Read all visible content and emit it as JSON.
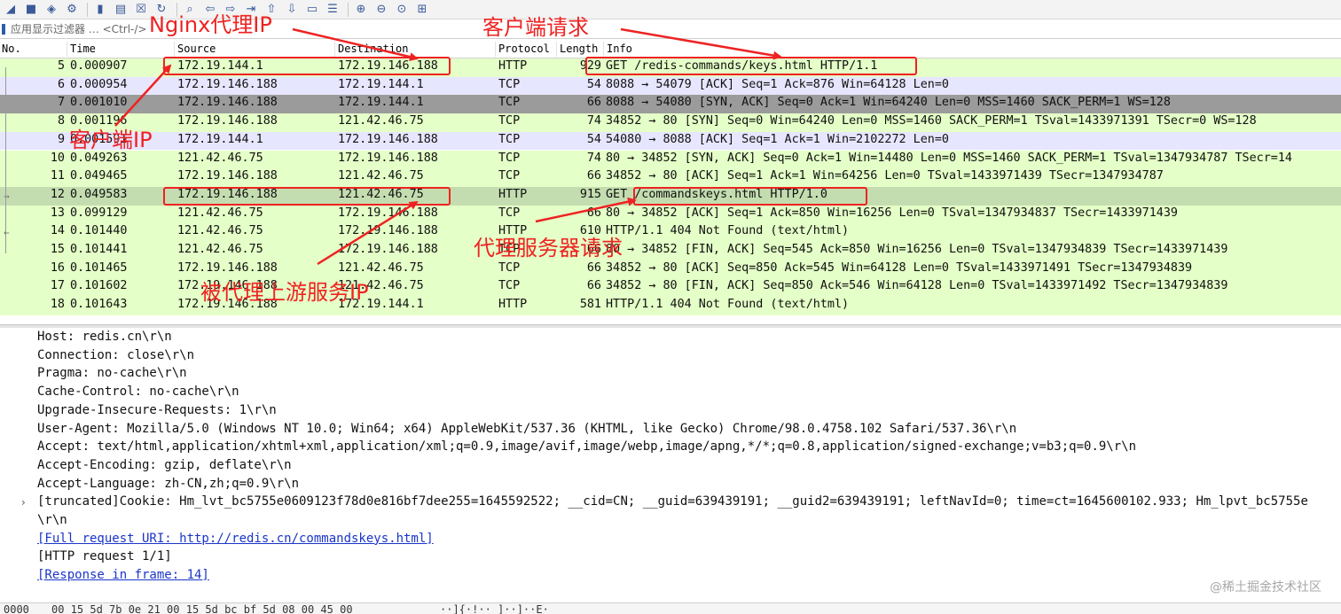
{
  "filter": {
    "placeholder": "应用显示过滤器 … <Ctrl-/>"
  },
  "columns": [
    "No.",
    "Time",
    "Source",
    "Destination",
    "Protocol",
    "Length",
    "Info"
  ],
  "packets": [
    {
      "no": "5",
      "time": "0.000907",
      "src": "172.19.144.1",
      "dst": "172.19.146.188",
      "proto": "HTTP",
      "len": "929",
      "info": "GET /redis-commands/keys.html HTTP/1.1",
      "bg": "#e4ffc7"
    },
    {
      "no": "6",
      "time": "0.000954",
      "src": "172.19.146.188",
      "dst": "172.19.144.1",
      "proto": "TCP",
      "len": "54",
      "info": "8088 → 54079 [ACK] Seq=1 Ack=876 Win=64128 Len=0",
      "bg": "#e7e6ff"
    },
    {
      "no": "7",
      "time": "0.001010",
      "src": "172.19.146.188",
      "dst": "172.19.144.1",
      "proto": "TCP",
      "len": "66",
      "info": "8088 → 54080 [SYN, ACK] Seq=0 Ack=1 Win=64240 Len=0 MSS=1460 SACK_PERM=1 WS=128",
      "bg": "#a0a0a0"
    },
    {
      "no": "8",
      "time": "0.001196",
      "src": "172.19.146.188",
      "dst": "121.42.46.75",
      "proto": "TCP",
      "len": "74",
      "info": "34852 → 80 [SYN] Seq=0 Win=64240 Len=0 MSS=1460 SACK_PERM=1 TSval=1433971391 TSecr=0 WS=128",
      "bg": "#e4ffc7"
    },
    {
      "no": "9",
      "time": "0.001591",
      "src": "172.19.144.1",
      "dst": "172.19.146.188",
      "proto": "TCP",
      "len": "54",
      "info": "54080 → 8088 [ACK] Seq=1 Ack=1 Win=2102272 Len=0",
      "bg": "#e7e6ff"
    },
    {
      "no": "10",
      "time": "0.049263",
      "src": "121.42.46.75",
      "dst": "172.19.146.188",
      "proto": "TCP",
      "len": "74",
      "info": "80 → 34852 [SYN, ACK] Seq=0 Ack=1 Win=14480 Len=0 MSS=1460 SACK_PERM=1 TSval=1347934787 TSecr=14",
      "bg": "#e4ffc7"
    },
    {
      "no": "11",
      "time": "0.049465",
      "src": "172.19.146.188",
      "dst": "121.42.46.75",
      "proto": "TCP",
      "len": "66",
      "info": "34852 → 80 [ACK] Seq=1 Ack=1 Win=64256 Len=0 TSval=1433971439 TSecr=1347934787",
      "bg": "#e4ffc7"
    },
    {
      "no": "12",
      "time": "0.049583",
      "src": "172.19.146.188",
      "dst": "121.42.46.75",
      "proto": "HTTP",
      "len": "915",
      "info": "GET /commandskeys.html HTTP/1.0",
      "bg": "#c4ddb0"
    },
    {
      "no": "13",
      "time": "0.099129",
      "src": "121.42.46.75",
      "dst": "172.19.146.188",
      "proto": "TCP",
      "len": "66",
      "info": "80 → 34852 [ACK] Seq=1 Ack=850 Win=16256 Len=0 TSval=1347934837 TSecr=1433971439",
      "bg": "#e4ffc7"
    },
    {
      "no": "14",
      "time": "0.101440",
      "src": "121.42.46.75",
      "dst": "172.19.146.188",
      "proto": "HTTP",
      "len": "610",
      "info": "HTTP/1.1 404 Not Found   (text/html)",
      "bg": "#e4ffc7"
    },
    {
      "no": "15",
      "time": "0.101441",
      "src": "121.42.46.75",
      "dst": "172.19.146.188",
      "proto": "TCP",
      "len": "66",
      "info": "80 → 34852 [FIN, ACK] Seq=545 Ack=850 Win=16256 Len=0 TSval=1347934839 TSecr=1433971439",
      "bg": "#e4ffc7"
    },
    {
      "no": "16",
      "time": "0.101465",
      "src": "172.19.146.188",
      "dst": "121.42.46.75",
      "proto": "TCP",
      "len": "66",
      "info": "34852 → 80 [ACK] Seq=850 Ack=545 Win=64128 Len=0 TSval=1433971491 TSecr=1347934839",
      "bg": "#e4ffc7"
    },
    {
      "no": "17",
      "time": "0.101602",
      "src": "172.19.146.188",
      "dst": "121.42.46.75",
      "proto": "TCP",
      "len": "66",
      "info": "34852 → 80 [FIN, ACK] Seq=850 Ack=546 Win=64128 Len=0 TSval=1433971492 TSecr=1347934839",
      "bg": "#e4ffc7"
    },
    {
      "no": "18",
      "time": "0.101643",
      "src": "172.19.146.188",
      "dst": "172.19.144.1",
      "proto": "HTTP",
      "len": "581",
      "info": "HTTP/1.1 404 Not Found   (text/html)",
      "bg": "#e4ffc7"
    }
  ],
  "details": [
    "Host: redis.cn\\r\\n",
    "Connection: close\\r\\n",
    "Pragma: no-cache\\r\\n",
    "Cache-Control: no-cache\\r\\n",
    "Upgrade-Insecure-Requests: 1\\r\\n",
    "User-Agent: Mozilla/5.0 (Windows NT 10.0; Win64; x64) AppleWebKit/537.36 (KHTML, like Gecko) Chrome/98.0.4758.102 Safari/537.36\\r\\n",
    "Accept: text/html,application/xhtml+xml,application/xml;q=0.9,image/avif,image/webp,image/apng,*/*;q=0.8,application/signed-exchange;v=b3;q=0.9\\r\\n",
    "Accept-Encoding: gzip, deflate\\r\\n",
    "Accept-Language: zh-CN,zh;q=0.9\\r\\n",
    " [truncated]Cookie: Hm_lvt_bc5755e0609123f78d0e816bf7dee255=1645592522; __cid=CN; __guid=639439191; __guid2=639439191; leftNavId=0; time=ct=1645600102.933; Hm_lpvt_bc5755e",
    "\\r\\n",
    "[Full request URI: http://redis.cn/commandskeys.html]",
    "[HTTP request 1/1]",
    "[Response in frame: 14]"
  ],
  "bytes": {
    "offset": "0000",
    "hex": "00 15 5d 7b 0e 21 00 15  5d bc bf 5d 08 00 45 00",
    "ascii": "··]{·!·· ]··]··E·"
  },
  "watermark": "@稀土掘金技术社区",
  "annotations": {
    "nginx_ip": "Nginx代理IP",
    "client_request": "客户端请求",
    "client_ip": "客户端IP",
    "proxy_request": "代理服务器请求",
    "upstream_ip": "被代理上游服务IP"
  },
  "colors": {
    "annotation": "#ee2222",
    "link": "#1a35c9",
    "tcp_http_row": "#e4ffc7",
    "local_row": "#e7e6ff"
  }
}
